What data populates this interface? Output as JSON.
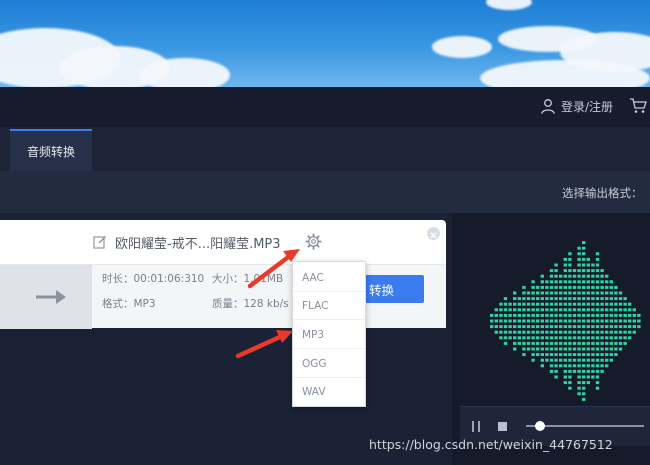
{
  "header": {
    "login_label": "登录/注册",
    "user_icon": "user-icon",
    "cart_icon": "cart-icon"
  },
  "tabs": [
    {
      "label": "音频转换",
      "active": true
    }
  ],
  "output_format": {
    "label": "选择输出格式："
  },
  "file": {
    "name": "欧阳耀莹-戒不...阳耀莹.MP3",
    "duration": "时长：00:01:06:310",
    "size": "大小：1.01MB",
    "format": "格式：MP3",
    "quality": "质量：128 kb/s",
    "convert_label": "转换"
  },
  "format_dropdown": {
    "options": [
      "AAC",
      "FLAC",
      "MP3",
      "OGG",
      "WAV"
    ]
  },
  "player": {
    "progress": 0.08
  },
  "watermark": "https://blog.csdn.net/weixin_44767512",
  "colors": {
    "accent": "#3a7bf0",
    "visualizer": "#2ed3a3",
    "annotation_arrow": "#e8392b"
  }
}
